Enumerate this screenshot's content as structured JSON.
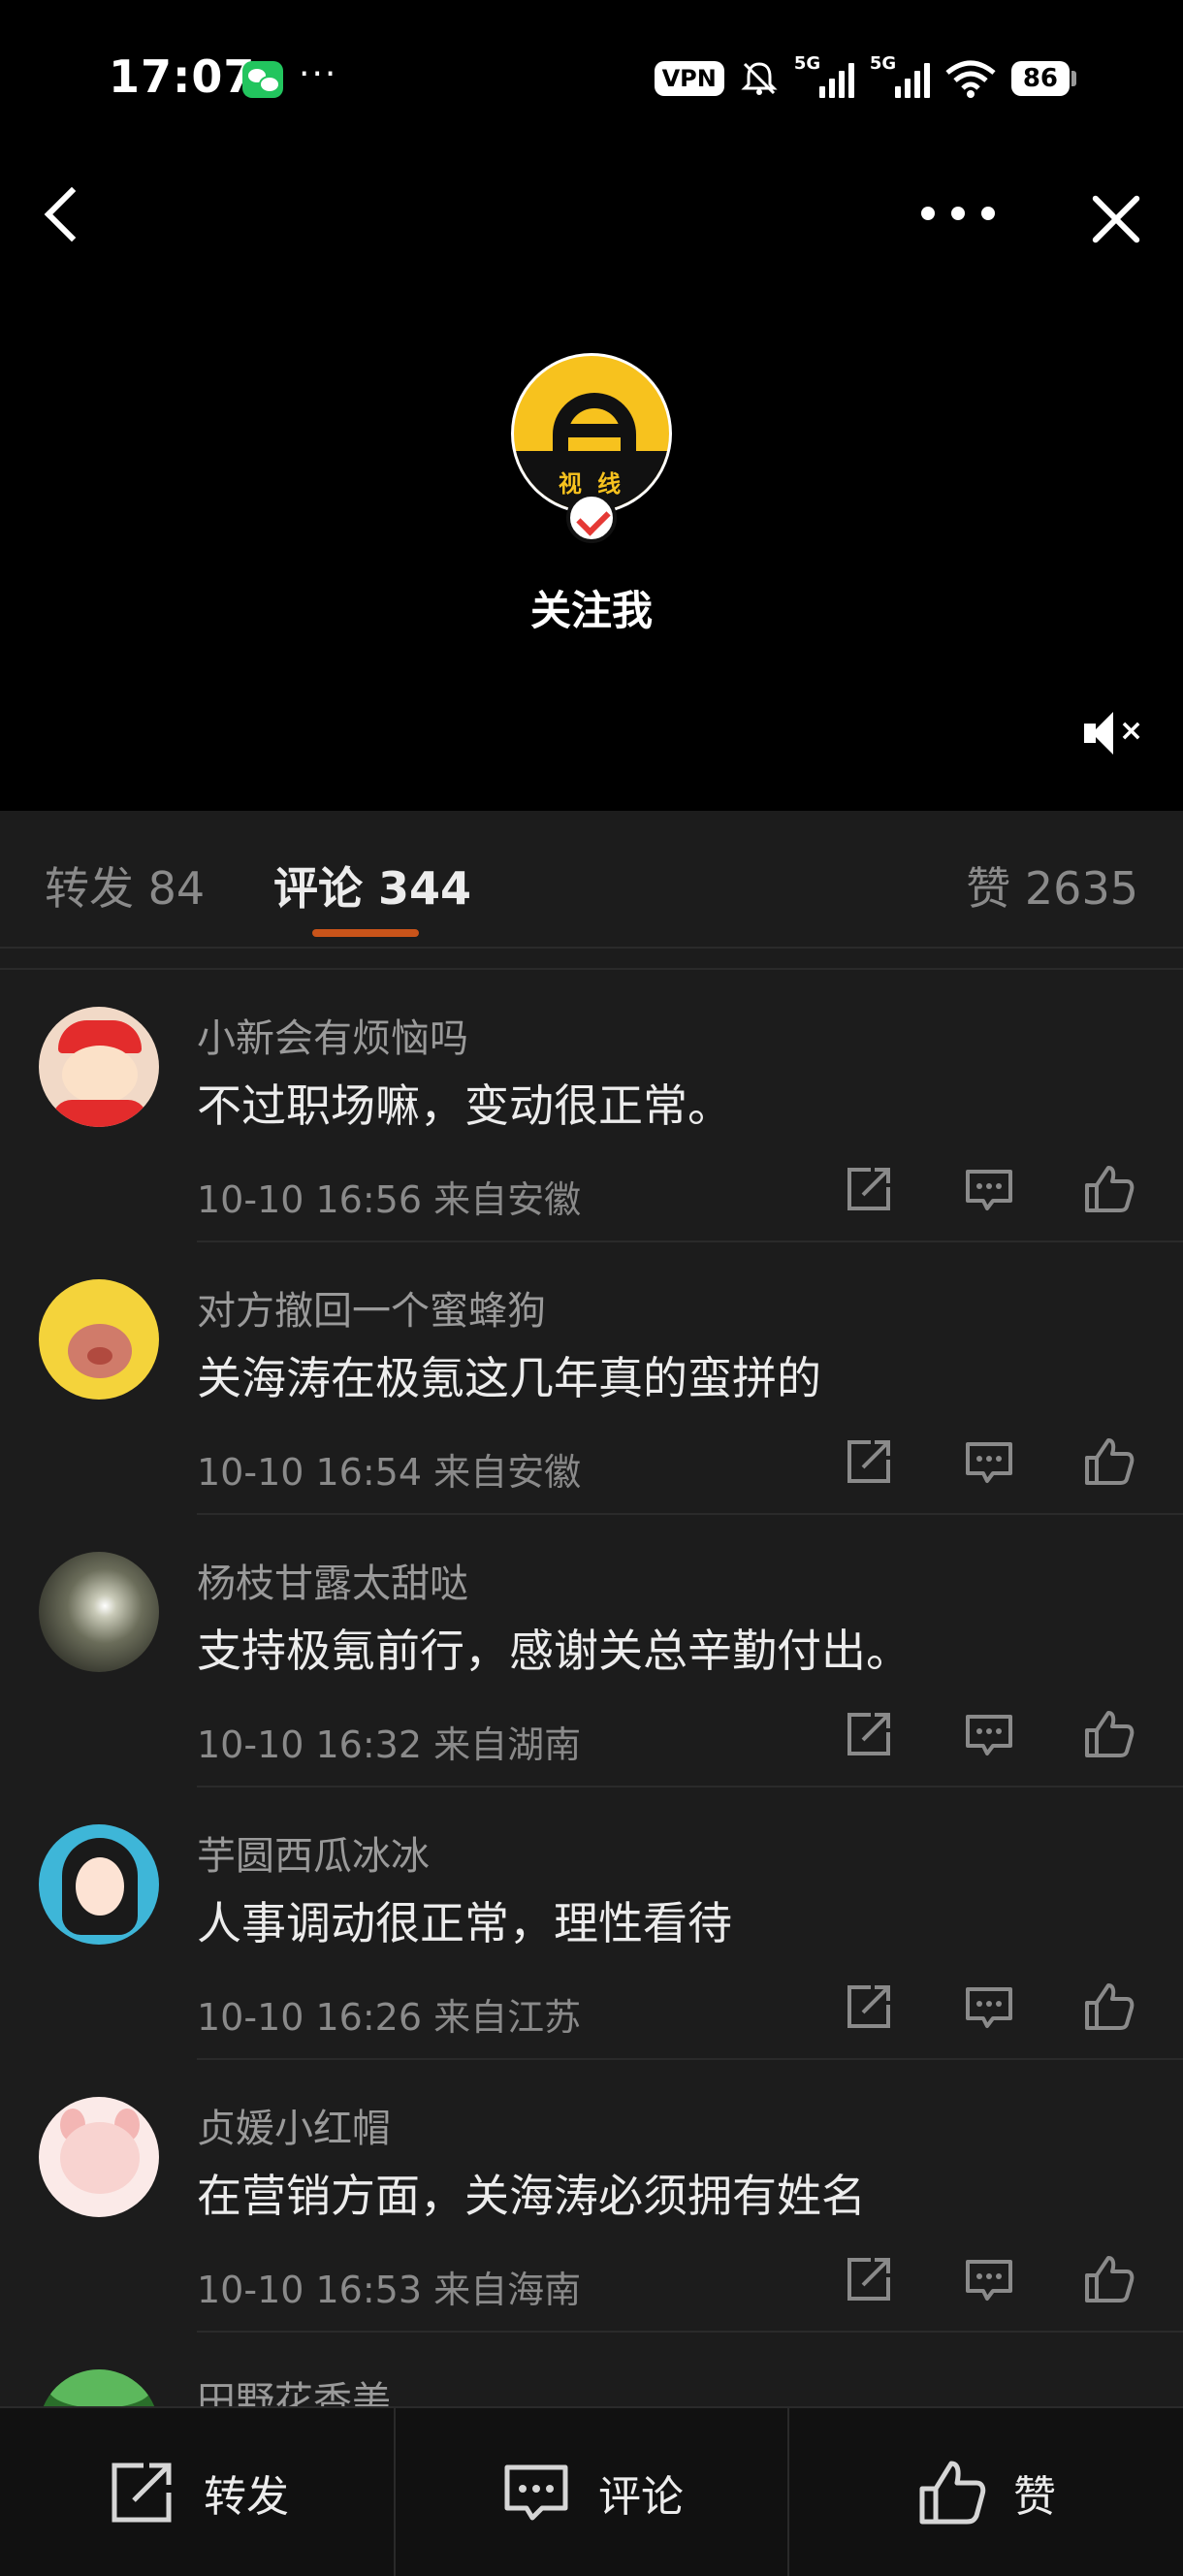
{
  "status_bar": {
    "time": "17:07",
    "vpn": "VPN",
    "network_1": "5G",
    "network_2": "5G",
    "battery": "86",
    "icons": [
      "wechat-icon",
      "more-dots-icon",
      "mute-bell-icon",
      "signal-icon",
      "wifi-icon",
      "battery-icon"
    ]
  },
  "header": {
    "icons": [
      "back-icon",
      "more-options-icon",
      "close-icon"
    ]
  },
  "video": {
    "brand_text": "视 线",
    "follow_title": "关注我",
    "icons": [
      "verified-icon",
      "mute-icon"
    ]
  },
  "tabs": {
    "repost": "转发 84",
    "comment": "评论 344",
    "like": "赞 2635",
    "active": "comment",
    "accent": "#c9541a"
  },
  "comments": [
    {
      "user": "小新会有烦恼吗",
      "text": "不过职场嘛，变动很正常。",
      "meta": "10-10 16:56  来自安徽"
    },
    {
      "user": "对方撤回一个蜜蜂狗",
      "text": "关海涛在极氪这几年真的蛮拼的",
      "meta": "10-10 16:54  来自安徽"
    },
    {
      "user": "杨枝甘露太甜哒",
      "text": "支持极氪前行，感谢关总辛勤付出。",
      "meta": "10-10 16:32  来自湖南"
    },
    {
      "user": "芋圆西瓜冰冰",
      "text": "人事调动很正常，理性看待",
      "meta": "10-10 16:26  来自江苏"
    },
    {
      "user": "贞媛小红帽",
      "text": "在营销方面，关海涛必须拥有姓名",
      "meta": "10-10 16:53  来自海南"
    },
    {
      "user": "田野花香美",
      "text": "",
      "meta": ""
    }
  ],
  "bottom_bar": {
    "repost": "转发",
    "comment": "评论",
    "like": "赞",
    "icons": [
      "share-icon",
      "comment-icon",
      "thumbs-up-icon"
    ]
  }
}
